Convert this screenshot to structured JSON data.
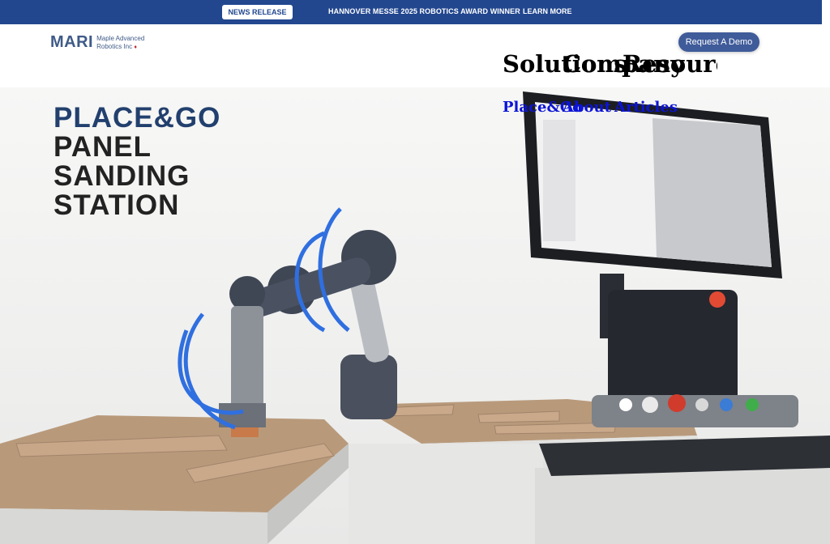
{
  "announcement": {
    "badge": "NEWS RELEASE",
    "text": "HANNOVER MESSE 2025 ROBOTICS AWARD WINNER",
    "link": "LEARN MORE"
  },
  "header": {
    "logo_mark": "MARI",
    "logo_line1": "Maple Advanced",
    "logo_line2": "Robotics Inc",
    "demo_button": "Request A Demo",
    "nav": [
      "Solutions",
      "Company",
      "Resources"
    ],
    "nav_sub": [
      "Place&Go",
      "About",
      "Articles"
    ]
  },
  "hero": {
    "title_line1": "PLACE&GO",
    "title_line2": "PANEL",
    "title_line3": "SANDING",
    "title_line4": "STATION"
  },
  "colors": {
    "brand_blue": "#22478f",
    "logo_blue": "#3f5b88",
    "button_blue": "#3f5b9a"
  }
}
